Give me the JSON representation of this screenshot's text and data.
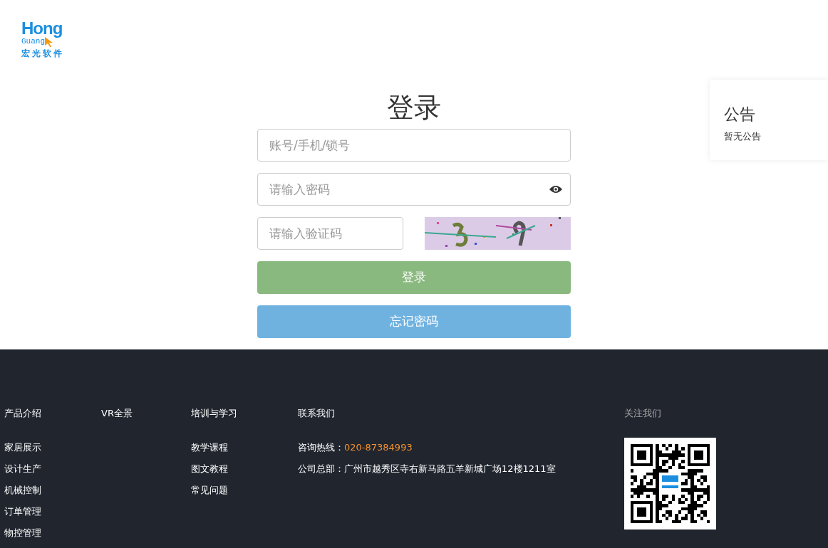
{
  "logo": {
    "line_1": "Hong",
    "line_2": "Guang",
    "name": "宏光软件"
  },
  "login": {
    "title": "登录",
    "account": {
      "placeholder": "账号/手机/锁号"
    },
    "password": {
      "placeholder": "请输入密码"
    },
    "captcha": {
      "placeholder": "请输入验证码"
    },
    "submit": "登录",
    "forgot": "忘记密码"
  },
  "notice": {
    "title": "公告",
    "text": "暂无公告"
  },
  "footer": {
    "columns": [
      {
        "heading": "产品介绍",
        "links": [
          "家居展示",
          "设计生产",
          "机械控制",
          "订单管理",
          "物控管理"
        ]
      },
      {
        "heading": "VR全景"
      },
      {
        "heading": "培训与学习",
        "links": [
          "教学课程",
          "图文教程",
          "常见问题"
        ]
      }
    ],
    "contact": {
      "heading": "联系我们",
      "hotline_label": "咨询热线：",
      "hotline": "020-87384993",
      "address": "公司总部：广州市越秀区寺右新马路五羊新城广场12楼1211室"
    },
    "follow": {
      "heading": "关注我们"
    }
  }
}
